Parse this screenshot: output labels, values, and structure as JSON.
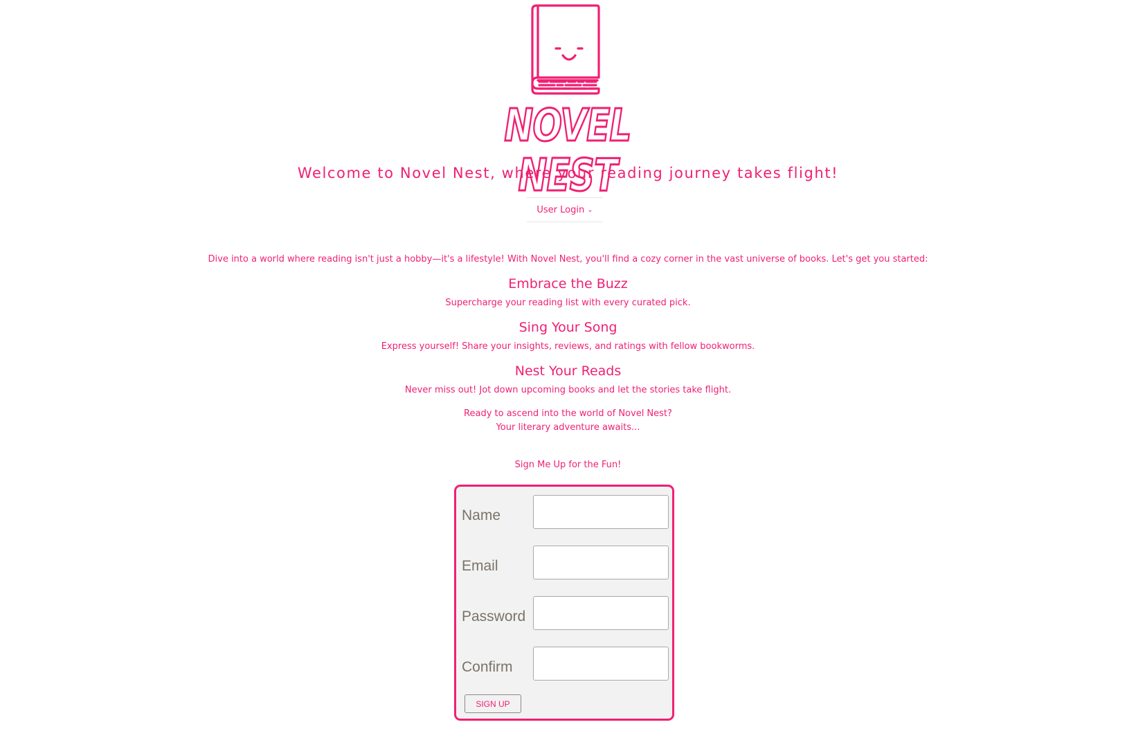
{
  "brand": {
    "logo_text": "NOVEL NEST",
    "accent_color": "#f01f73"
  },
  "welcome": "Welcome to Novel Nest, where your reading journey takes flight!",
  "login_toggle": {
    "label": "User Login",
    "icon": "chevron-down-icon"
  },
  "intro": "Dive into a world where reading isn't just a hobby—it's a lifestyle! With Novel Nest, you'll find a cozy corner in the vast universe of books. Let's get you started:",
  "features": [
    {
      "title": "Embrace the Buzz",
      "desc": "Supercharge your reading list with every curated pick."
    },
    {
      "title": "Sing Your Song",
      "desc": "Express yourself! Share your insights, reviews, and ratings with fellow bookworms."
    },
    {
      "title": "Nest Your Reads",
      "desc": "Never miss out! Jot down upcoming books and let the stories take flight."
    }
  ],
  "ready": {
    "line1": "Ready to ascend into the world of Novel Nest?",
    "line2": "Your literary adventure awaits..."
  },
  "signup_prompt": "Sign Me Up for the Fun!",
  "form": {
    "fields": [
      {
        "label": "Name",
        "value": ""
      },
      {
        "label": "Email",
        "value": ""
      },
      {
        "label": "Password",
        "value": ""
      },
      {
        "label": "Confirm",
        "value": ""
      }
    ],
    "submit_label": "SIGN UP"
  }
}
